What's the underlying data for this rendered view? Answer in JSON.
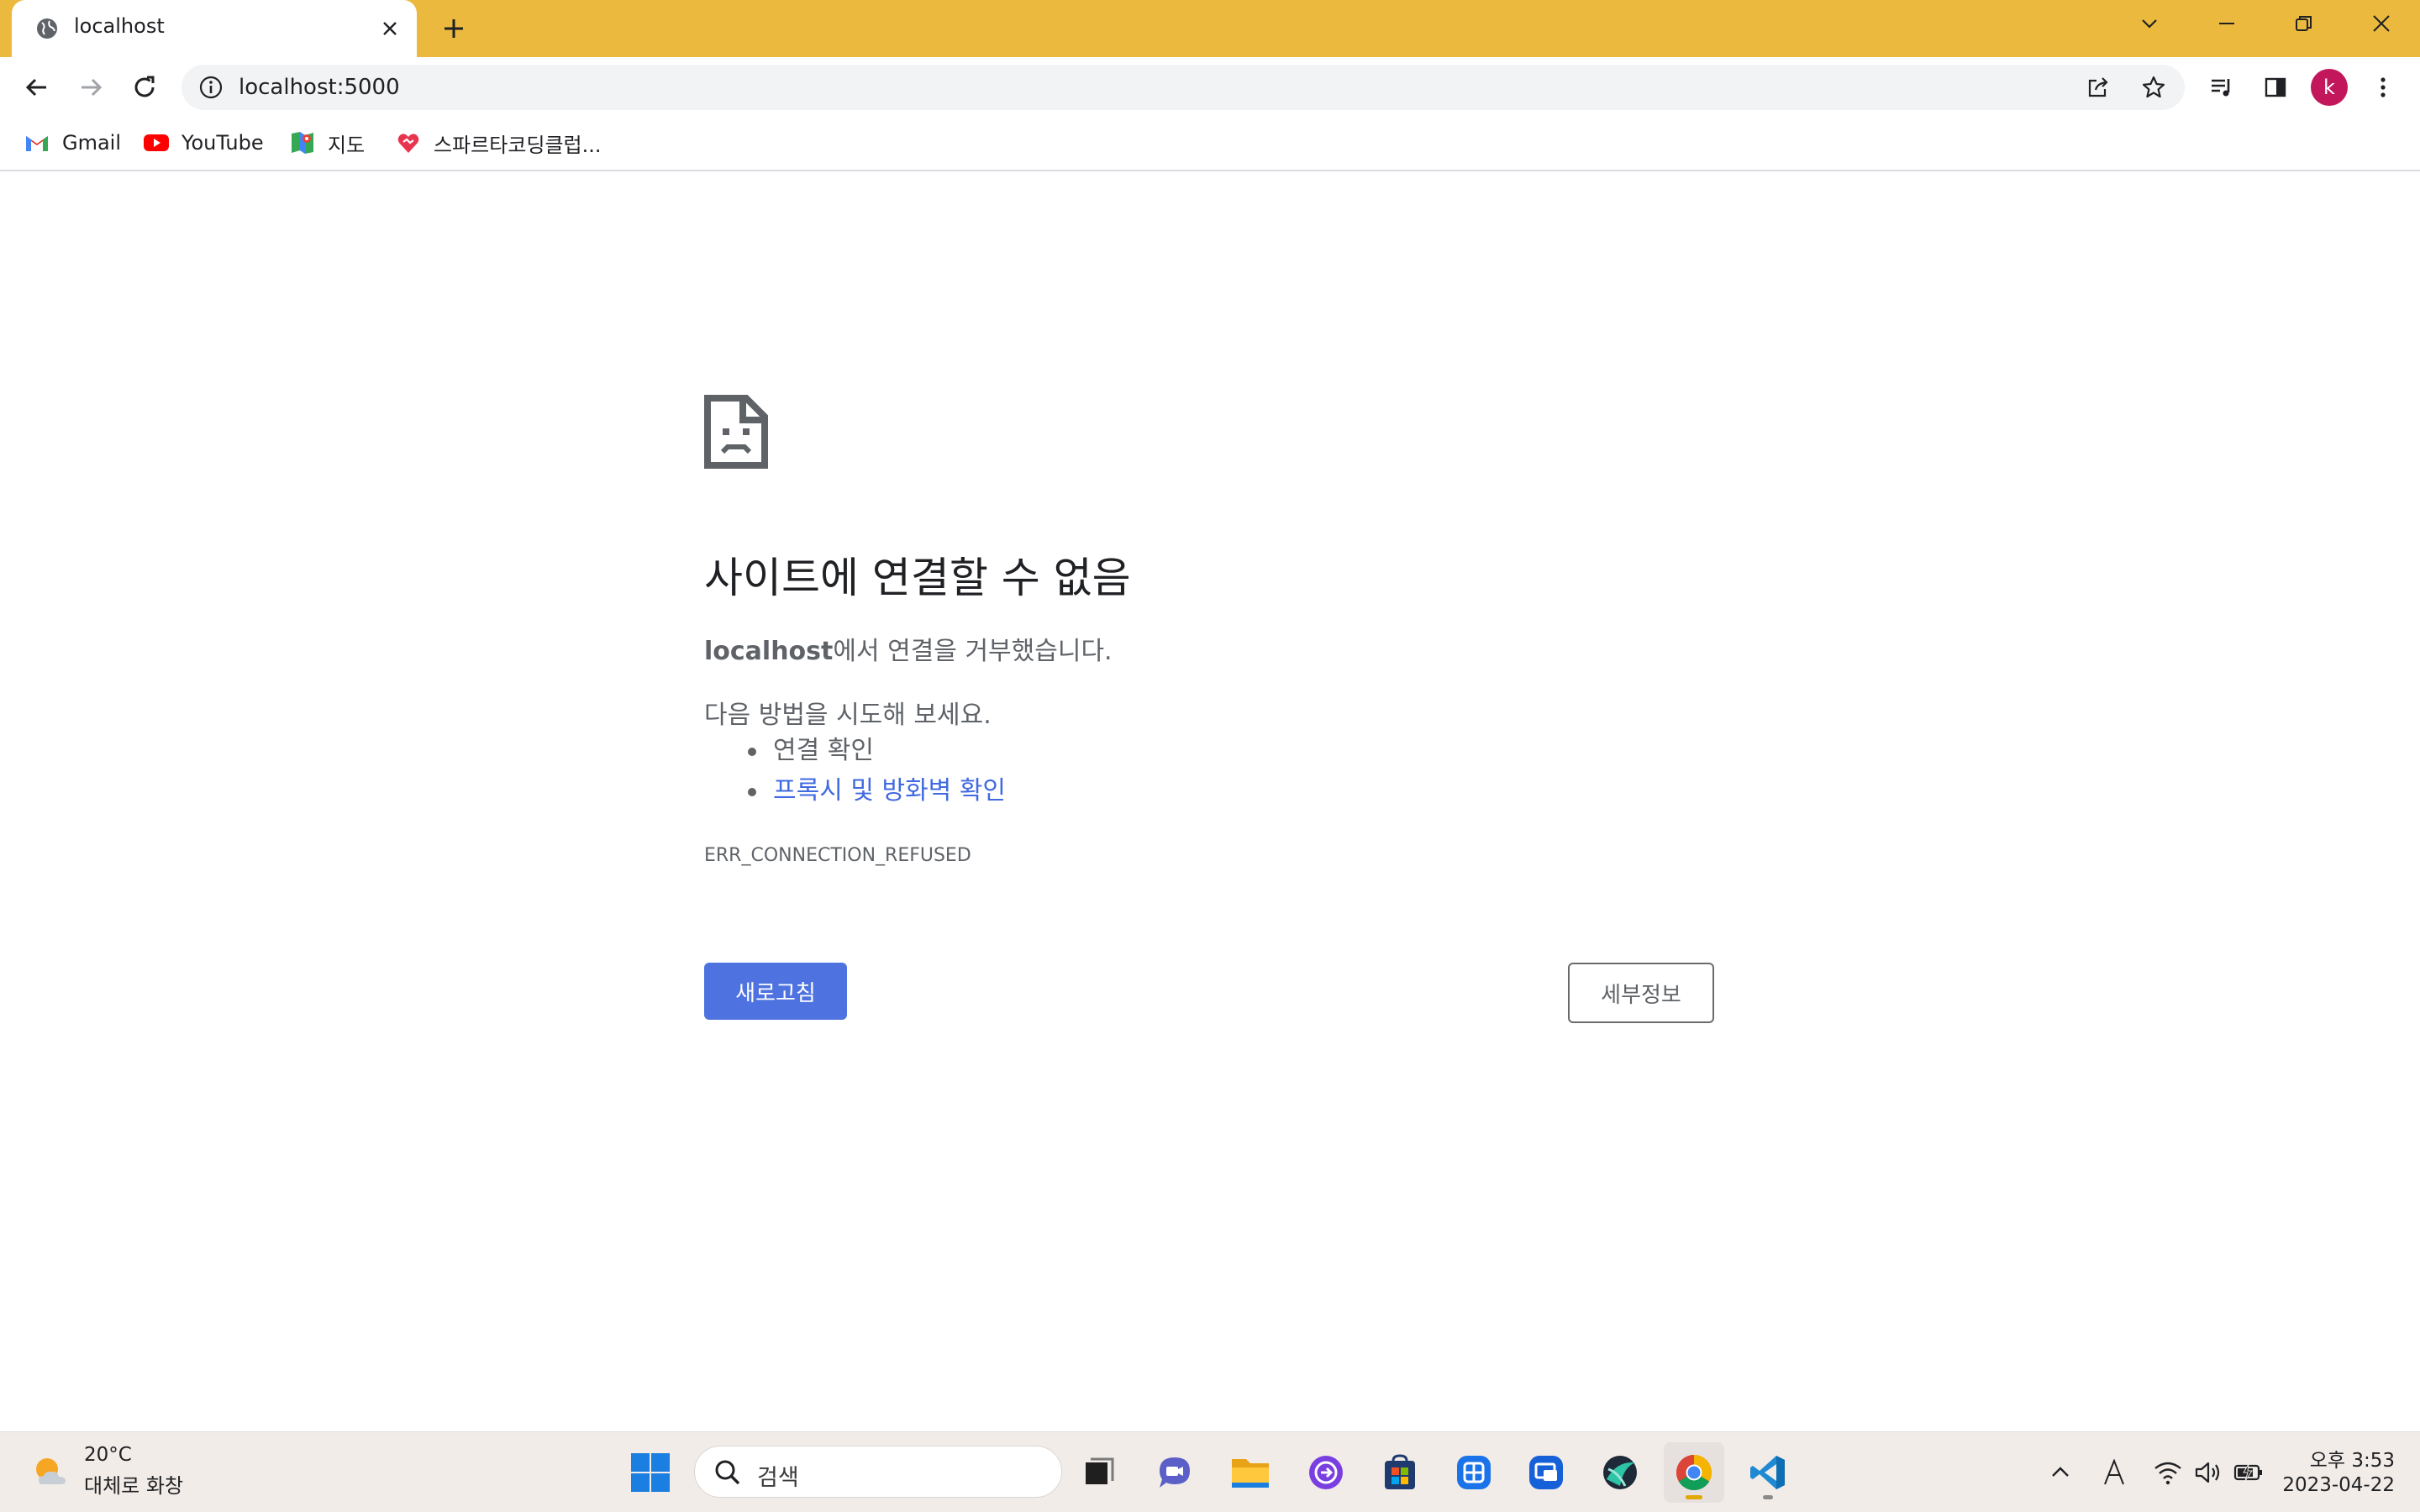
{
  "tab": {
    "title": "localhost"
  },
  "omnibox": {
    "url": "localhost:5000"
  },
  "profile": {
    "initial": "k"
  },
  "bookmarks": [
    {
      "label": "Gmail",
      "icon": "gmail-icon"
    },
    {
      "label": "YouTube",
      "icon": "youtube-icon"
    },
    {
      "label": "지도",
      "icon": "maps-icon"
    },
    {
      "label": "스파르타코딩클럽...",
      "icon": "sparta-icon"
    }
  ],
  "error": {
    "heading": "사이트에 연결할 수 없음",
    "host": "localhost",
    "host_suffix": "에서 연결을 거부했습니다.",
    "try_label": "다음 방법을 시도해 보세요.",
    "suggestions": [
      "연결 확인",
      "프록시 및 방화벽 확인"
    ],
    "code": "ERR_CONNECTION_REFUSED",
    "reload_label": "새로고침",
    "details_label": "세부정보"
  },
  "taskbar": {
    "weather_temp": "20°C",
    "weather_desc": "대체로 화창",
    "search_placeholder": "검색",
    "time": "오후 3:53",
    "date": "2023-04-22"
  },
  "colors": {
    "titlebar": "#ebb93d",
    "accent_button": "#4e73e0",
    "link": "#4169e1",
    "avatar": "#c2185b"
  }
}
